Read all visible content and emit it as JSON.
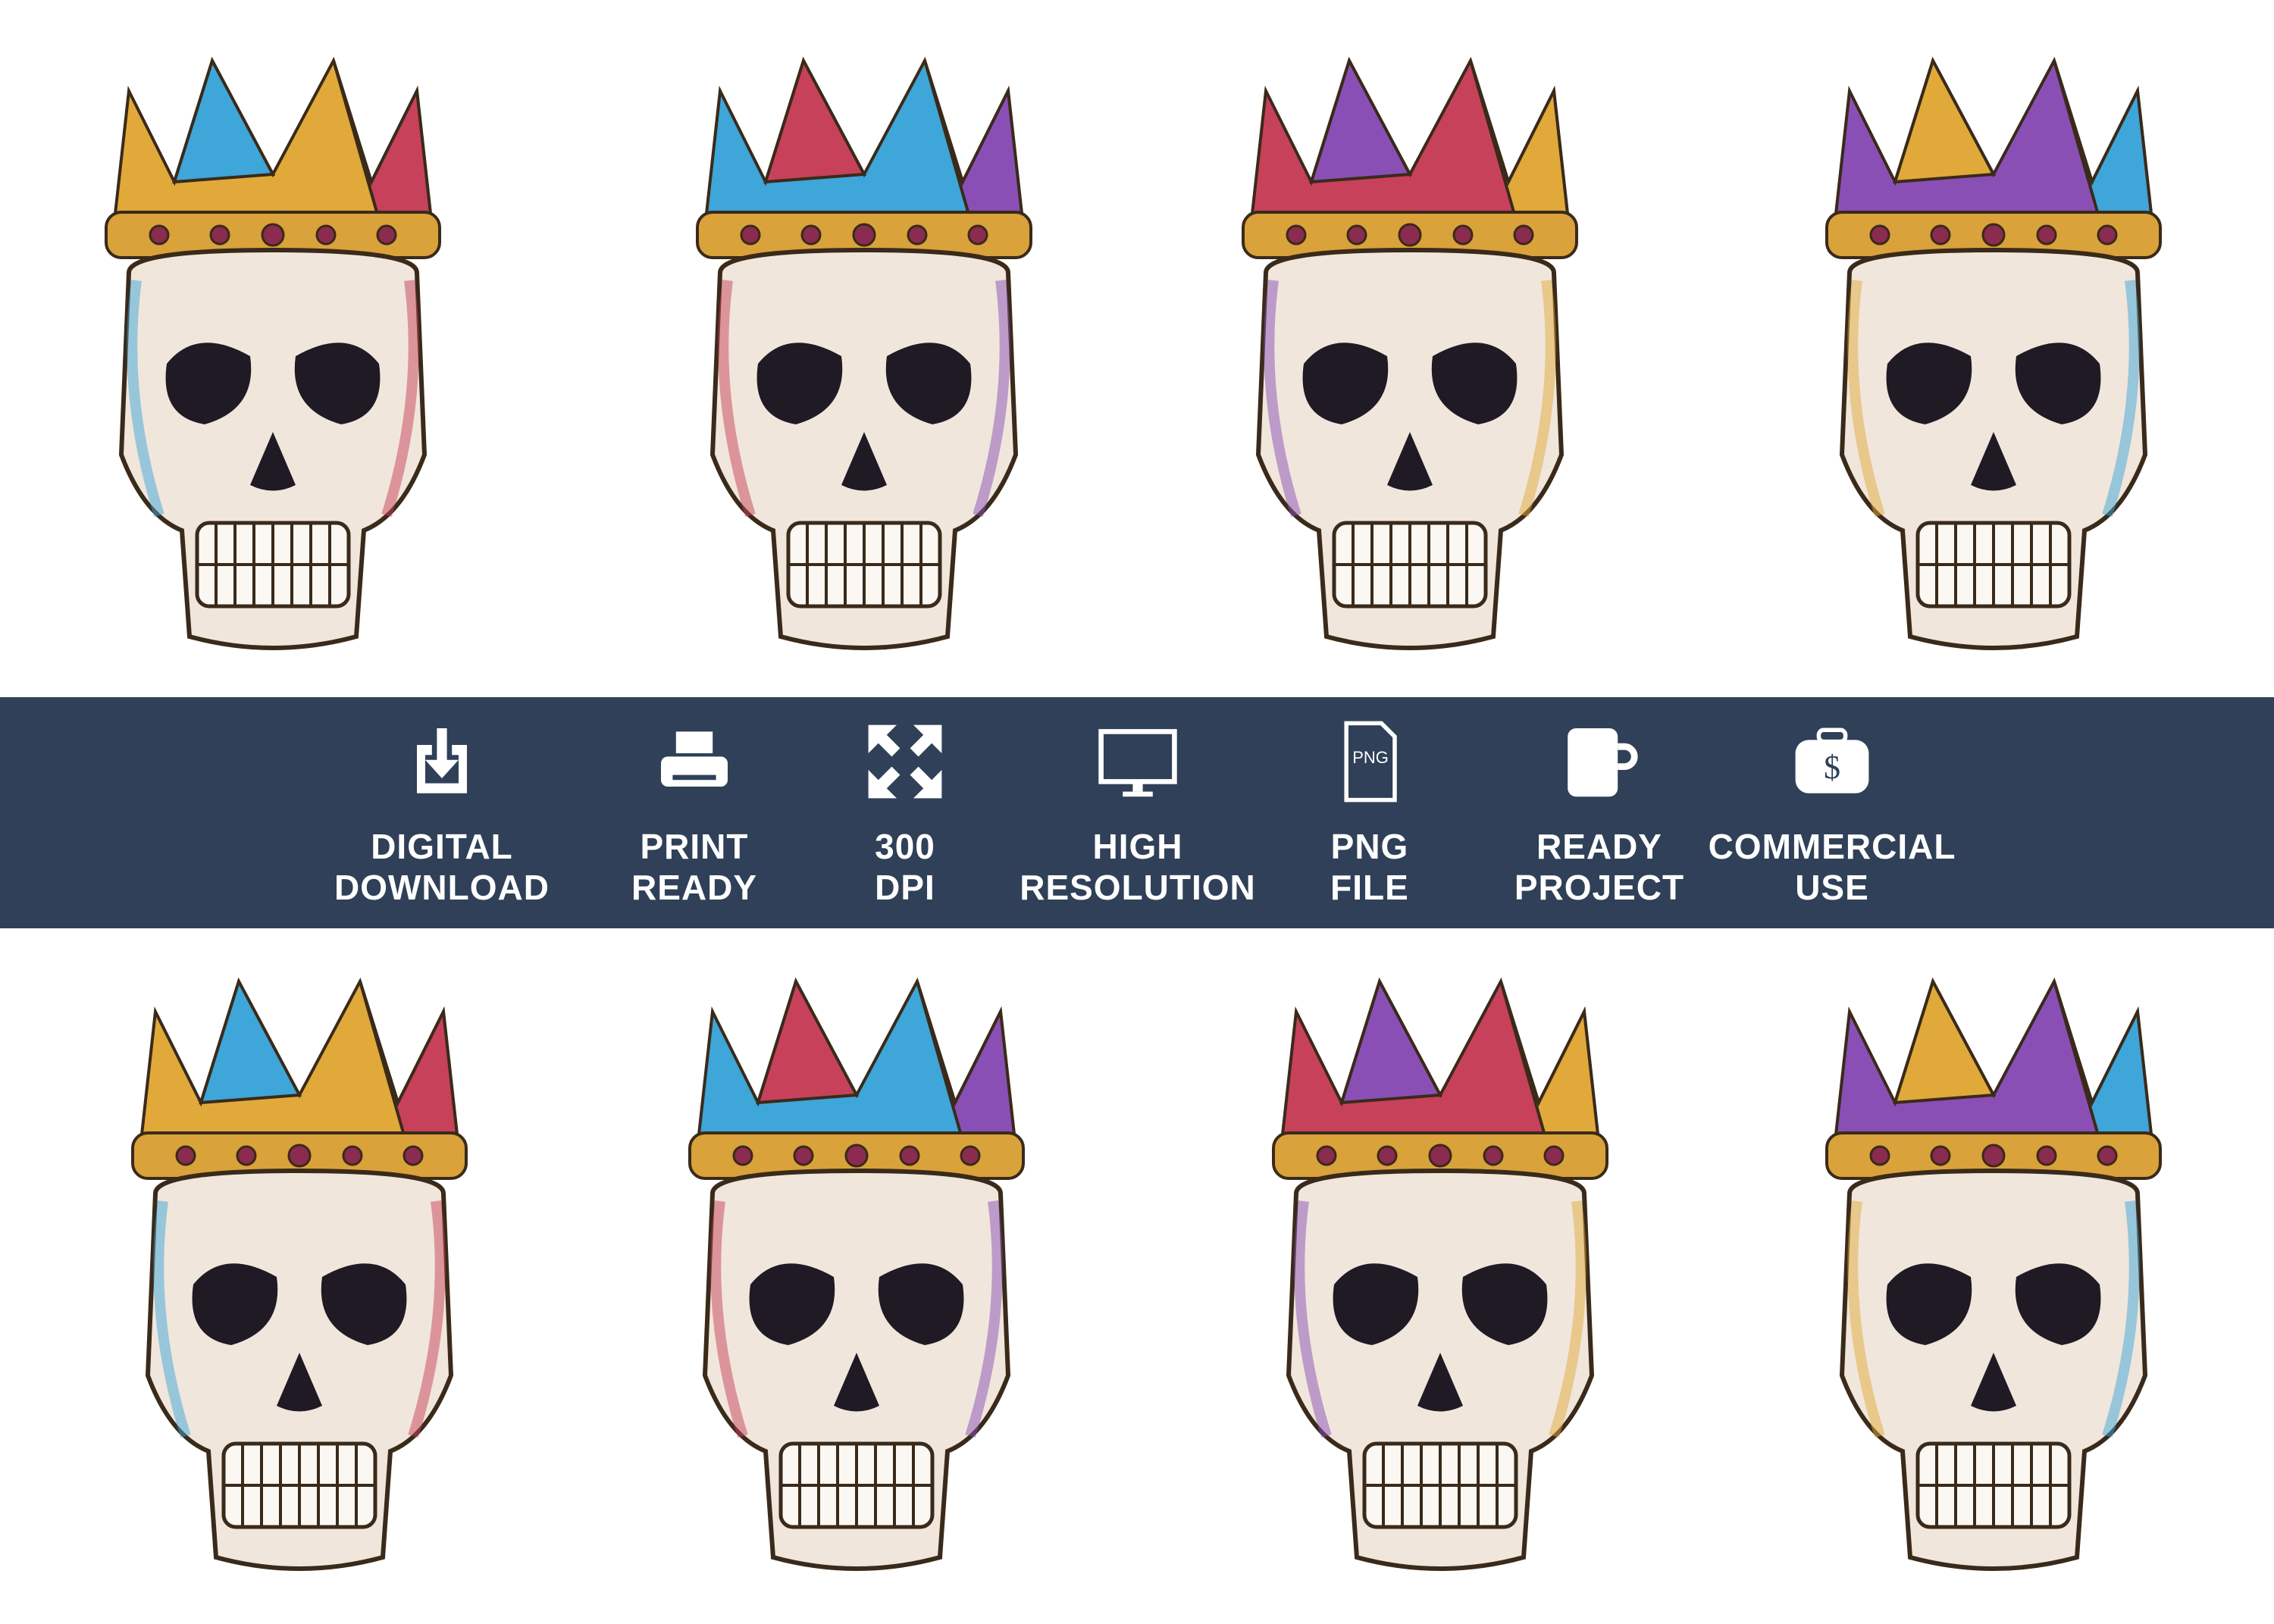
{
  "banner": {
    "background": "#2f4058",
    "features": [
      {
        "icon": "download-icon",
        "line1": "DIGITAL",
        "line2": "DOWNLOAD"
      },
      {
        "icon": "printer-icon",
        "line1": "PRINT",
        "line2": "READY"
      },
      {
        "icon": "expand-arrows-icon",
        "line1": "300",
        "line2": "DPI"
      },
      {
        "icon": "monitor-icon",
        "line1": "HIGH",
        "line2": "RESOLUTION"
      },
      {
        "icon": "png-file-icon",
        "icon_text": "PNG",
        "line1": "PNG",
        "line2": "FILE"
      },
      {
        "icon": "mug-icon",
        "line1": "READY",
        "line2": "PROJECT"
      },
      {
        "icon": "money-bag-icon",
        "icon_text": "$",
        "line1": "COMMERCIAL",
        "line2": "USE"
      }
    ]
  },
  "skulls": {
    "count": 8,
    "crown_colors": [
      "#e0a93a",
      "#3ea6d8",
      "#c7415a",
      "#8a4fb5"
    ]
  }
}
